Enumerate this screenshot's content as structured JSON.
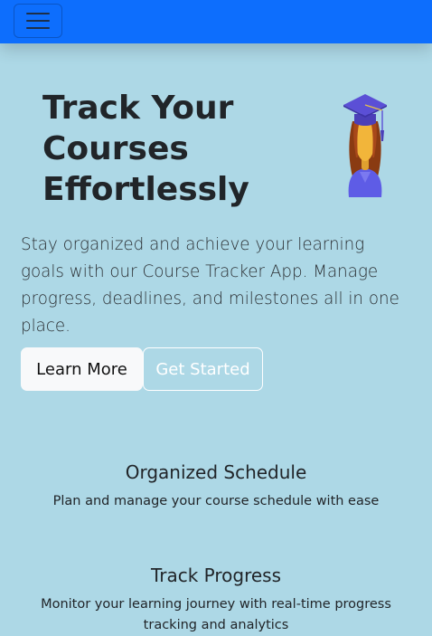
{
  "navbar": {
    "toggler_icon": "hamburger-menu-icon",
    "background": "#0D6EFD"
  },
  "hero": {
    "title_lines": [
      "Track Your",
      "Courses",
      "Effortlessly"
    ],
    "icon": "graduation-student-icon",
    "description": "Stay organized and achieve your learning goals with our Course Tracker App. Manage progress, deadlines, and milestones all in one place.",
    "buttons": {
      "learn_more": "Learn More",
      "get_started": "Get Started"
    }
  },
  "features": [
    {
      "title": "Organized Schedule",
      "description": "Plan and manage your course schedule with ease"
    },
    {
      "title": "Track Progress",
      "description": "Monitor your learning journey with real-time progress tracking and analytics"
    }
  ],
  "colors": {
    "page_background": "#ADD8E6",
    "primary": "#0D6EFD",
    "text": "#212529"
  }
}
